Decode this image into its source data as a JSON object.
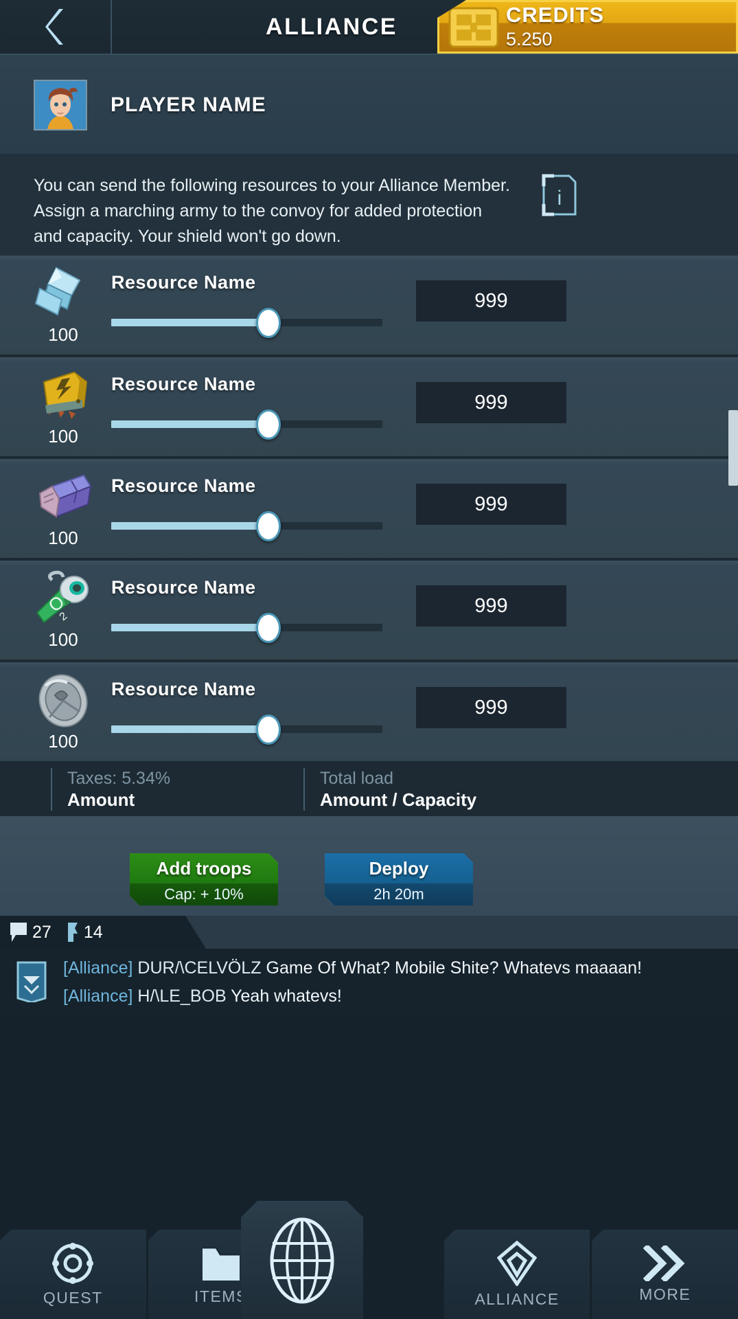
{
  "topbar": {
    "back_icon": "chevron-left-icon",
    "title": "ALLIANCE",
    "credits_label": "CREDITS",
    "credits_value": "5.250",
    "credits_icon": "chip-card-icon"
  },
  "player": {
    "name": "PLAYER NAME",
    "avatar_icon": "player-portrait-icon"
  },
  "description": {
    "text": "You can send the following resources to your Alliance Member. Assign a marching army to the convoy for added protection and capacity. Your shield won't go down.",
    "info_icon": "info-icon"
  },
  "resources": [
    {
      "icon": "crystal-shard-icon",
      "name": "Resource Name",
      "owned": "100",
      "value": "999",
      "slider_percent": 58
    },
    {
      "icon": "energy-cell-icon",
      "name": "Resource Name",
      "owned": "100",
      "value": "999",
      "slider_percent": 58
    },
    {
      "icon": "metal-ingot-icon",
      "name": "Resource Name",
      "owned": "100",
      "value": "999",
      "slider_percent": 58
    },
    {
      "icon": "oxygen-canister-icon",
      "name": "Resource Name",
      "owned": "100",
      "value": "999",
      "slider_percent": 58
    },
    {
      "icon": "alloy-disc-icon",
      "name": "Resource Name",
      "owned": "100",
      "value": "999",
      "slider_percent": 58
    }
  ],
  "totals": {
    "taxes_label": "Taxes: 5.34%",
    "taxes_value": "Amount",
    "load_label": "Total load",
    "load_value": "Amount / Capacity"
  },
  "actions": {
    "add_troops_label": "Add troops",
    "add_troops_sub": "Cap: + 10%",
    "deploy_label": "Deploy",
    "deploy_sub": "2h 20m"
  },
  "chat": {
    "tab_messages_icon": "speech-bubble-icon",
    "tab_messages_count": "27",
    "tab_mail_icon": "mail-flag-icon",
    "tab_mail_count": "14",
    "avatar_icon": "envelope-icon",
    "lines": [
      {
        "channel": "[Alliance]",
        "user": "DUR/\\CELVÖLZ",
        "message": "Game Of What? Mobile Shite? Whatevs maaaan!"
      },
      {
        "channel": "[Alliance]",
        "user": "H/\\LE_BOB",
        "message": "Yeah whatevs!"
      }
    ]
  },
  "nav": {
    "items": [
      {
        "icon": "lifebuoy-icon",
        "label": "QUEST"
      },
      {
        "icon": "folder-icon",
        "label": "ITEMS"
      },
      {
        "icon": "globe-icon",
        "label": ""
      },
      {
        "icon": "diamond-icon",
        "label": "ALLIANCE"
      },
      {
        "icon": "chevrons-right-icon",
        "label": "MORE"
      }
    ]
  },
  "colors": {
    "accent_blue": "#a8d7ea",
    "credits_gold": "#e3a713",
    "add_troops_green": "#5fd021",
    "deploy_blue": "#39b6f0"
  }
}
